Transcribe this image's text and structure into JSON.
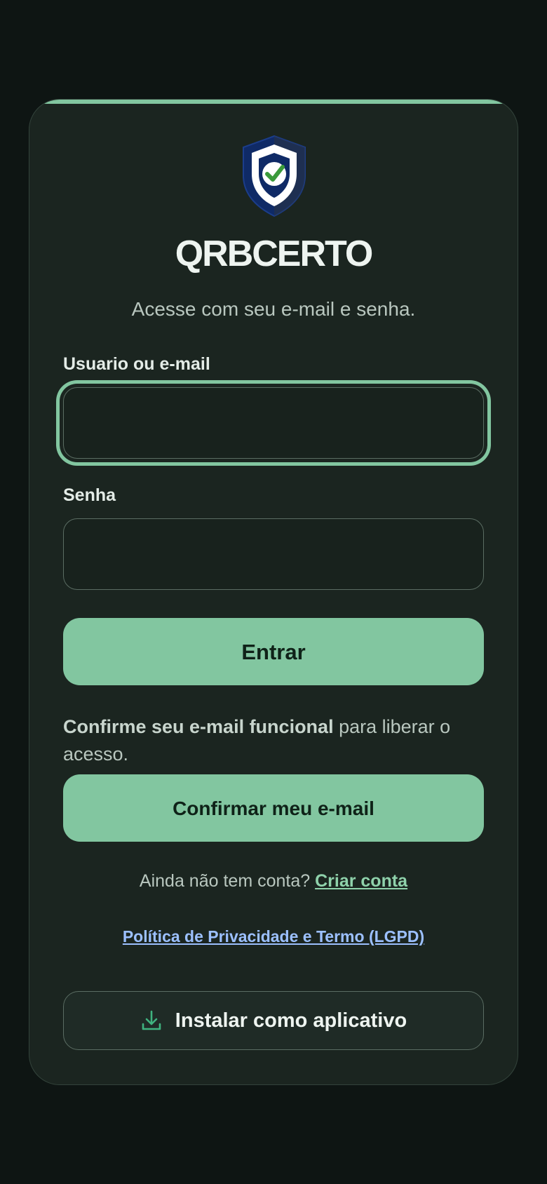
{
  "brand": {
    "name": "QRBCERTO",
    "logo_icon": "shield-check-icon"
  },
  "subtitle": "Acesse com seu e-mail e senha.",
  "form": {
    "username_label": "Usuario ou e-mail",
    "username_value": "",
    "password_label": "Senha",
    "password_value": "",
    "submit_label": "Entrar"
  },
  "confirm": {
    "bold_text": "Confirme seu e-mail funcional",
    "rest_text": " para liberar o acesso.",
    "button_label": "Confirmar meu e-mail"
  },
  "signup": {
    "prompt": "Ainda não tem conta? ",
    "link_label": "Criar conta"
  },
  "privacy_link": "Política de Privacidade e Termo (LGPD)",
  "install": {
    "label": "Instalar como aplicativo",
    "icon": "download-icon"
  },
  "colors": {
    "accent": "#82c6a0",
    "background": "#0e1513",
    "card": "#1b2520",
    "link_blue": "#9cc0ff"
  }
}
